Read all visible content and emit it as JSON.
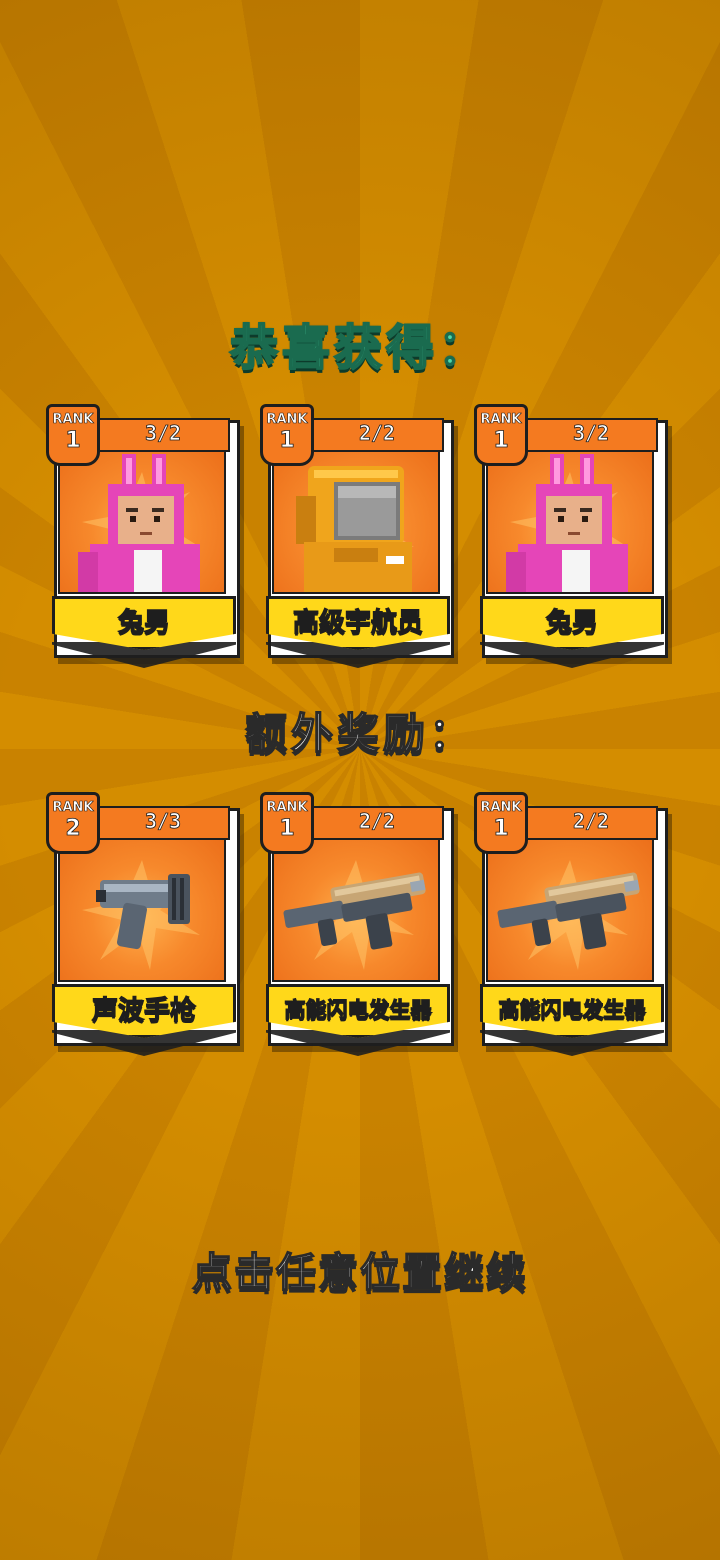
{
  "header": {
    "title": "恭喜获得："
  },
  "rewards": [
    {
      "rank_label": "RANK",
      "rank": "1",
      "count": "3/2",
      "name": "兔男",
      "icon": "bunny-character-icon"
    },
    {
      "rank_label": "RANK",
      "rank": "1",
      "count": "2/2",
      "name": "高级宇航员",
      "icon": "astronaut-character-icon"
    },
    {
      "rank_label": "RANK",
      "rank": "1",
      "count": "3/2",
      "name": "兔男",
      "icon": "bunny-character-icon"
    }
  ],
  "bonus": {
    "title": "额外奖励："
  },
  "bonus_rewards": [
    {
      "rank_label": "RANK",
      "rank": "2",
      "count": "3/3",
      "name": "声波手枪",
      "icon": "sonic-pistol-icon"
    },
    {
      "rank_label": "RANK",
      "rank": "1",
      "count": "2/2",
      "name": "高能闪电发生器",
      "icon": "lightning-generator-gun-icon"
    },
    {
      "rank_label": "RANK",
      "rank": "1",
      "count": "2/2",
      "name": "高能闪电发生器",
      "icon": "lightning-generator-gun-icon"
    }
  ],
  "footer": {
    "continue_hint": "点击任意位置继续"
  },
  "colors": {
    "background": "#d48d00",
    "title_green": "#4fd9a9",
    "card_orange": "#f47a20",
    "ribbon_yellow": "#ffd81a"
  }
}
